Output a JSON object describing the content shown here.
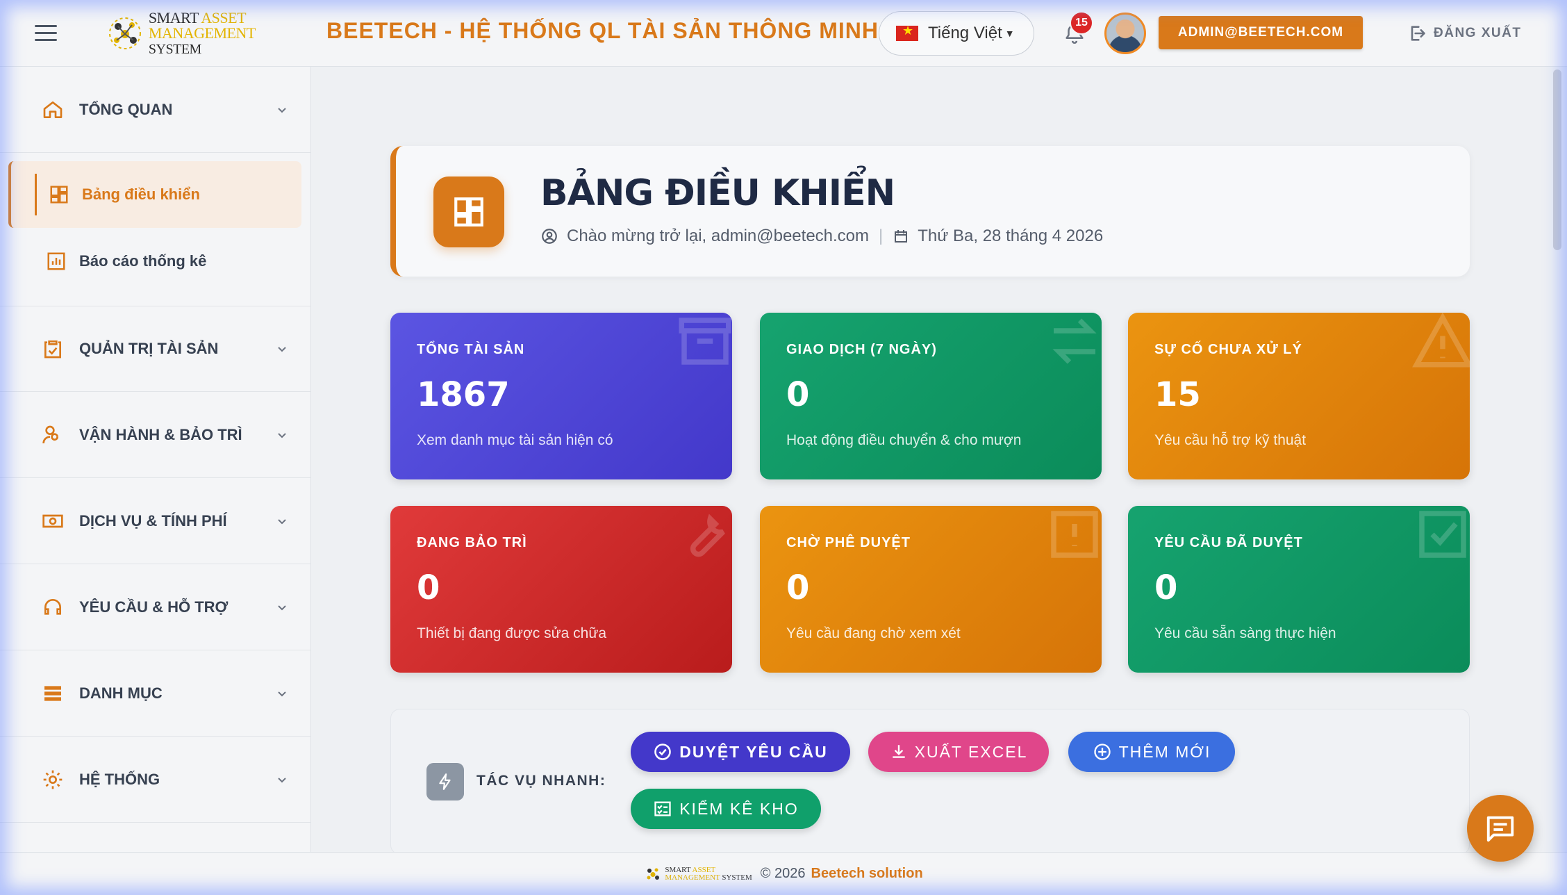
{
  "header": {
    "logo_line1_a": "SMART",
    "logo_line1_b": "ASSET",
    "logo_line2_a": "MANAGEMENT",
    "logo_line2_b": "SYSTEM",
    "app_title": "BEETECH - HỆ THỐNG QL TÀI SẢN THÔNG MINH",
    "language": "Tiếng Việt",
    "notification_count": "15",
    "user_email": "ADMIN@BEETECH.COM",
    "logout_label": "ĐĂNG XUẤT"
  },
  "sidebar": {
    "groups": [
      {
        "label": "TỔNG QUAN",
        "icon": "home-icon"
      },
      {
        "label": "QUẢN TRỊ TÀI SẢN",
        "icon": "clipboard-check-icon"
      },
      {
        "label": "VẬN HÀNH & BẢO TRÌ",
        "icon": "user-gear-icon"
      },
      {
        "label": "DỊCH VỤ & TÍNH PHÍ",
        "icon": "money-icon"
      },
      {
        "label": "YÊU CẦU & HỖ TRỢ",
        "icon": "headset-icon"
      },
      {
        "label": "DANH MỤC",
        "icon": "list-icon"
      },
      {
        "label": "HỆ THỐNG",
        "icon": "gear-icon"
      }
    ],
    "subitems": [
      {
        "label": "Bảng điều khiển",
        "icon": "dashboard-icon",
        "active": true
      },
      {
        "label": "Báo cáo thống kê",
        "icon": "chart-icon",
        "active": false
      }
    ]
  },
  "page": {
    "title": "BẢNG ĐIỀU KHIỂN",
    "welcome": "Chào mừng trở lại, admin@beetech.com",
    "date": "Thứ Ba, 28 tháng 4 2026"
  },
  "stats": [
    {
      "label": "TỔNG TÀI SẢN",
      "value": "1867",
      "desc": "Xem danh mục tài sản hiện có",
      "color": "#4f46e5",
      "icon": "archive-icon"
    },
    {
      "label": "GIAO DỊCH (7 NGÀY)",
      "value": "0",
      "desc": "Hoạt động điều chuyển & cho mượn",
      "color": "#10a06b",
      "icon": "exchange-icon"
    },
    {
      "label": "SỰ CỐ CHƯA XỬ LÝ",
      "value": "15",
      "desc": "Yêu cầu hỗ trợ kỹ thuật",
      "color": "#e58a0e",
      "icon": "warning-icon"
    },
    {
      "label": "ĐANG BẢO TRÌ",
      "value": "0",
      "desc": "Thiết bị đang được sửa chữa",
      "color": "#dc2626",
      "icon": "wrench-icon"
    },
    {
      "label": "CHỜ PHÊ DUYỆT",
      "value": "0",
      "desc": "Yêu cầu đang chờ xem xét",
      "color": "#e58a0e",
      "icon": "alert-icon"
    },
    {
      "label": "YÊU CẦU ĐÃ DUYỆT",
      "value": "0",
      "desc": "Yêu cầu sẵn sàng thực hiện",
      "color": "#10a06b",
      "icon": "check-icon"
    }
  ],
  "quick_actions": {
    "label": "TÁC VỤ NHANH:",
    "buttons": [
      {
        "label": "DUYỆT YÊU CẦU",
        "color": "#4338ca",
        "icon": "check-circle-icon"
      },
      {
        "label": "XUẤT EXCEL",
        "color": "#e0468a",
        "icon": "download-icon"
      },
      {
        "label": "THÊM MỚI",
        "color": "#3b6fe0",
        "icon": "plus-circle-icon"
      },
      {
        "label": "KIỂM KÊ KHO",
        "color": "#10a06b",
        "icon": "checklist-icon"
      }
    ]
  },
  "footer": {
    "copyright": "© 2026",
    "company": "Beetech solution"
  }
}
